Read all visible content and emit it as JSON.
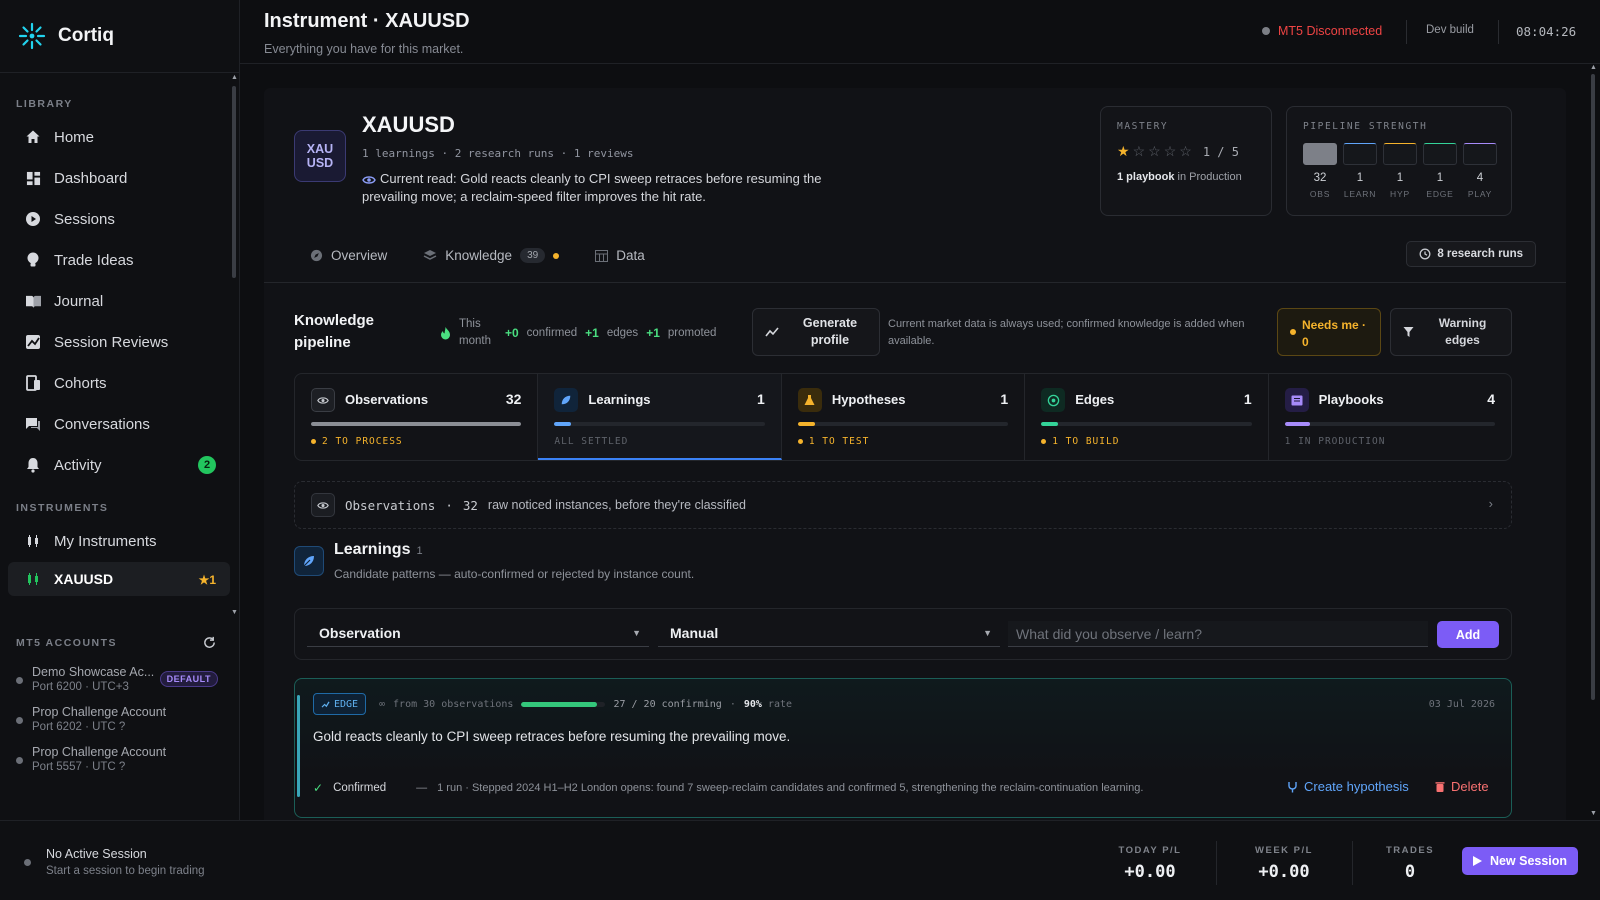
{
  "brand": {
    "name": "Cortiq"
  },
  "sidebar": {
    "library_label": "LIBRARY",
    "items": [
      {
        "label": "Home",
        "icon": "home-icon"
      },
      {
        "label": "Dashboard",
        "icon": "dashboard-icon"
      },
      {
        "label": "Sessions",
        "icon": "play-circle-icon"
      },
      {
        "label": "Trade Ideas",
        "icon": "lightbulb-icon"
      },
      {
        "label": "Journal",
        "icon": "book-icon"
      },
      {
        "label": "Session Reviews",
        "icon": "chart-review-icon"
      },
      {
        "label": "Cohorts",
        "icon": "cohorts-icon"
      },
      {
        "label": "Conversations",
        "icon": "chat-icon"
      },
      {
        "label": "Activity",
        "icon": "bell-icon",
        "badge": "2"
      }
    ],
    "instruments_label": "INSTRUMENTS",
    "instrument_items": [
      {
        "label": "My Instruments",
        "icon": "candles-icon"
      },
      {
        "label": "XAUUSD",
        "icon": "candles-icon",
        "badge": "★1"
      }
    ],
    "mt5_label": "MT5 ACCOUNTS",
    "accounts": [
      {
        "name": "Demo Showcase Ac...",
        "port": "Port 6200 · UTC+3",
        "badge": "DEFAULT"
      },
      {
        "name": "Prop Challenge Account",
        "port": "Port 6202 · UTC ?"
      },
      {
        "name": "Prop Challenge Account",
        "port": "Port 5557 · UTC ?"
      }
    ]
  },
  "header": {
    "title": "Instrument · XAUUSD",
    "subtitle": "Everything you have for this market.",
    "mt5_status": "MT5 Disconnected",
    "build": "Dev build",
    "clock": "08:04:26"
  },
  "instrument": {
    "logo_line1": "XAU",
    "logo_line2": "USD",
    "name": "XAUUSD",
    "meta": "1 learnings · 2 research runs · 1 reviews",
    "current_read": "Current read: Gold reacts cleanly to CPI sweep retraces before resuming the prevailing move; a reclaim-speed filter improves the hit rate."
  },
  "mastery": {
    "label": "MASTERY",
    "stars_filled": 1,
    "stars_total": 5,
    "ratio": "1 / 5",
    "playbook_bold": "1 playbook",
    "playbook_rest": " in Production"
  },
  "pipeline_strength": {
    "label": "PIPELINE STRENGTH",
    "cells": [
      {
        "value": "32",
        "label": "OBS",
        "color": "#8b8e95"
      },
      {
        "value": "1",
        "label": "LEARN",
        "color": "#60a5fa"
      },
      {
        "value": "1",
        "label": "HYP",
        "color": "#f5b32c"
      },
      {
        "value": "1",
        "label": "EDGE",
        "color": "#34d399"
      },
      {
        "value": "4",
        "label": "PLAY",
        "color": "#a78bfa"
      }
    ]
  },
  "tabs": [
    {
      "label": "Overview"
    },
    {
      "label": "Knowledge",
      "count": "39"
    },
    {
      "label": "Data"
    }
  ],
  "research_runs_label": "8 research runs",
  "pipeline": {
    "title_line1": "Knowledge",
    "title_line2": "pipeline",
    "this_month_1": "This",
    "this_month_2": "month",
    "confirmed_val": "+0",
    "confirmed_lbl": "confirmed",
    "edges_val": "+1",
    "edges_lbl": "edges",
    "promoted_val": "+1",
    "promoted_lbl": "promoted",
    "generate_1": "Generate",
    "generate_2": "profile",
    "note": "Current market data is always used; confirmed knowledge is added when available.",
    "needs_me_1": "Needs me ·",
    "needs_me_2": "0",
    "warning_1": "Warning",
    "warning_2": "edges"
  },
  "stages": [
    {
      "name": "Observations",
      "count": "32",
      "status": "2 TO PROCESS",
      "fill": 1.0,
      "color": "#8b8e95",
      "icon": "eye-icon",
      "muted": false
    },
    {
      "name": "Learnings",
      "count": "1",
      "status": "ALL SETTLED",
      "fill": 0.08,
      "color": "#60a5fa",
      "icon": "leaf-icon",
      "muted": true
    },
    {
      "name": "Hypotheses",
      "count": "1",
      "status": "1 TO TEST",
      "fill": 0.08,
      "color": "#f5b32c",
      "icon": "flask-icon",
      "muted": false
    },
    {
      "name": "Edges",
      "count": "1",
      "status": "1 TO BUILD",
      "fill": 0.08,
      "color": "#34d399",
      "icon": "target-icon",
      "muted": false
    },
    {
      "name": "Playbooks",
      "count": "4",
      "status": "1 IN PRODUCTION",
      "fill": 0.12,
      "color": "#a78bfa",
      "icon": "playbook-icon",
      "muted": true
    }
  ],
  "observations_row": {
    "label": "Observations",
    "count": "32",
    "desc": "raw noticed instances, before they're classified"
  },
  "learnings": {
    "title": "Learnings",
    "count": "1",
    "subtitle": "Candidate patterns — auto-confirmed or rejected by instance count."
  },
  "form": {
    "type_value": "Observation",
    "source_value": "Manual",
    "placeholder": "What did you observe / learn?",
    "add_label": "Add"
  },
  "edge_card": {
    "badge": "EDGE",
    "from": "from 30 observations",
    "progress": 0.9,
    "confirming": "27 / 20 confirming",
    "rate_bold": "90%",
    "rate_rest": "rate",
    "date": "03 Jul 2026",
    "text": "Gold reacts cleanly to CPI sweep retraces before resuming the prevailing move.",
    "status": "Confirmed",
    "dash": "—",
    "run_note": "1 run · Stepped 2024 H1–H2 London opens: found 7 sweep-reclaim candidates and confirmed 5, strengthening the reclaim-continuation learning.",
    "create_hypothesis": "Create hypothesis",
    "delete": "Delete"
  },
  "bottom": {
    "session_title": "No Active Session",
    "session_sub": "Start a session to begin trading",
    "today_label": "TODAY P/L",
    "today_value": "+0.00",
    "week_label": "WEEK P/L",
    "week_value": "+0.00",
    "trades_label": "TRADES",
    "trades_value": "0",
    "new_session": "New Session"
  },
  "colors": {
    "accent": "#7c5cf6",
    "danger": "#ef4444",
    "success": "#4ade80",
    "warning": "#f5b32c",
    "info": "#60a5fa"
  }
}
